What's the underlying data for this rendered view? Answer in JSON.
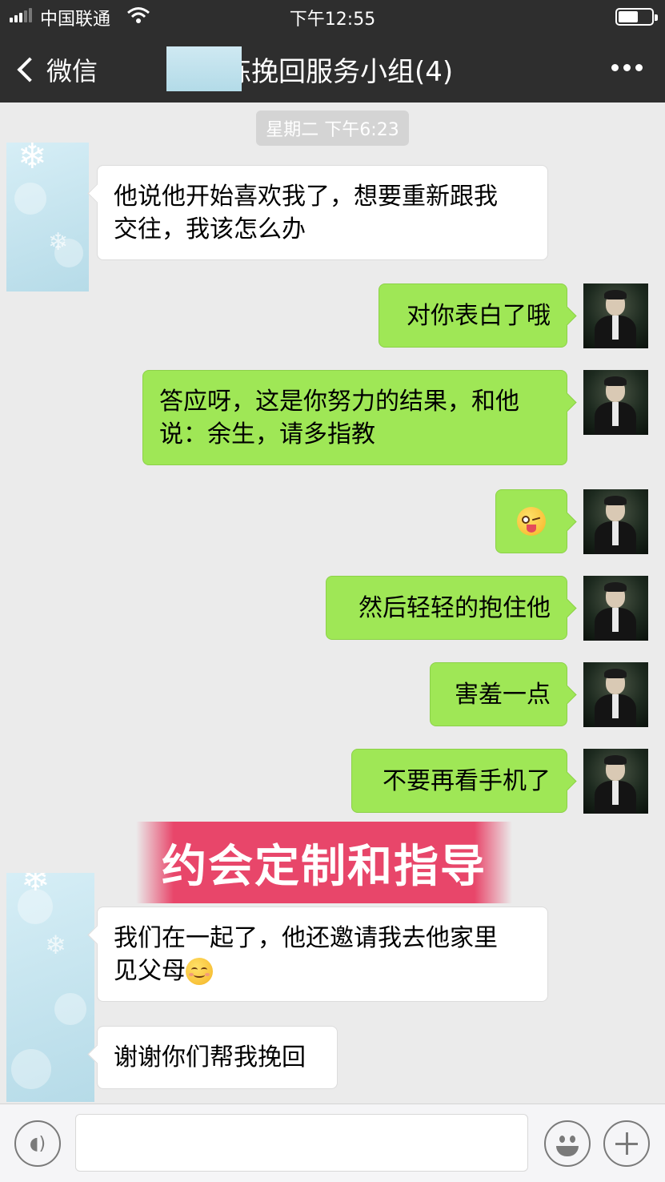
{
  "status_bar": {
    "carrier": "中国联通",
    "time": "下午12:55"
  },
  "nav": {
    "back_label": "微信",
    "title": "练挽回服务小组(4)"
  },
  "timestamp": "星期二 下午6:23",
  "messages": [
    {
      "side": "left",
      "text": "他说他开始喜欢我了，想要重新跟我\n交往，我该怎么办"
    },
    {
      "side": "right",
      "text": "对你表白了哦"
    },
    {
      "side": "right",
      "text": "答应呀，这是你努力的结果，和他\n说：余生，请多指教"
    },
    {
      "side": "right",
      "emoji": "winking-face-with-tongue"
    },
    {
      "side": "right",
      "text": "然后轻轻的抱住他"
    },
    {
      "side": "right",
      "text": "害羞一点"
    },
    {
      "side": "right",
      "text": "不要再看手机了"
    },
    {
      "side": "left",
      "text_line1": "我们在一起了，他还邀请我去他家里",
      "text_line2": "见父母",
      "emoji": "smiling-face-with-smiling-eyes"
    },
    {
      "side": "left",
      "text": "谢谢你们帮我挽回"
    }
  ],
  "banner": {
    "text": "约会定制和指导",
    "color": "#e8466a"
  },
  "colors": {
    "outgoing_bubble": "#9fe756",
    "incoming_bubble": "#ffffff",
    "nav_bg": "#2e2e2e",
    "chat_bg": "#ebebeb"
  }
}
